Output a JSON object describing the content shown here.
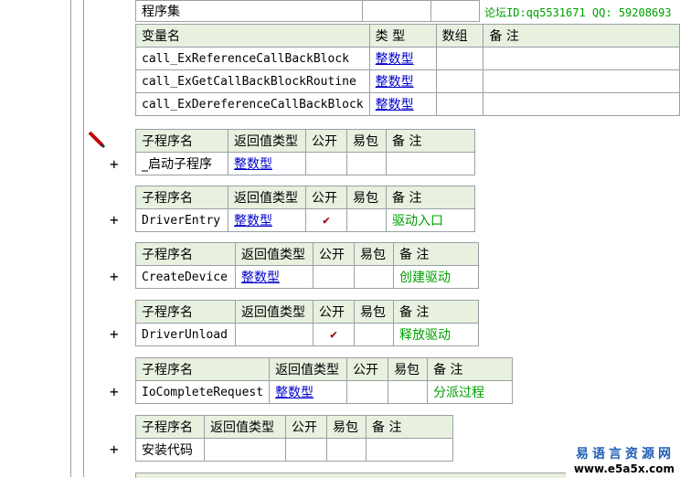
{
  "header": {
    "assembly_label": "程序集",
    "forum_id_text": "论坛ID:qq5531671 QQ: 59208693"
  },
  "variables": {
    "col_name": "变量名",
    "col_type": "类 型",
    "col_array": "数组",
    "col_note": "备 注",
    "rows": [
      {
        "name": "call_ExReferenceCallBackBlock",
        "type": "整数型"
      },
      {
        "name": "call_ExGetCallBackBlockRoutine",
        "type": "整数型"
      },
      {
        "name": "call_ExDereferenceCallBackBlock",
        "type": "整数型"
      }
    ]
  },
  "sub_headers": {
    "name": "子程序名",
    "ret": "返回值类型",
    "public": "公开",
    "easy": "易包",
    "note": "备 注"
  },
  "subroutines": [
    {
      "name": "_启动子程序",
      "ret": "整数型",
      "public": "",
      "note": "",
      "expand": "+"
    },
    {
      "name": "DriverEntry",
      "ret": "整数型",
      "public": "✔",
      "note": "驱动入口",
      "expand": "+"
    },
    {
      "name": "CreateDevice",
      "ret": "整数型",
      "public": "",
      "note": "创建驱动",
      "expand": "+"
    },
    {
      "name": "DriverUnload",
      "ret": "",
      "public": "✔",
      "note": "释放驱动",
      "expand": "+"
    },
    {
      "name": "IoCompleteRequest",
      "ret": "整数型",
      "public": "",
      "note": "分派过程",
      "expand": "+"
    },
    {
      "name": "安装代码",
      "ret": "",
      "public": "",
      "note": "",
      "expand": "+"
    }
  ],
  "watermark": {
    "line1": "易语言资源网",
    "line2": "www.e5a5x.com"
  }
}
